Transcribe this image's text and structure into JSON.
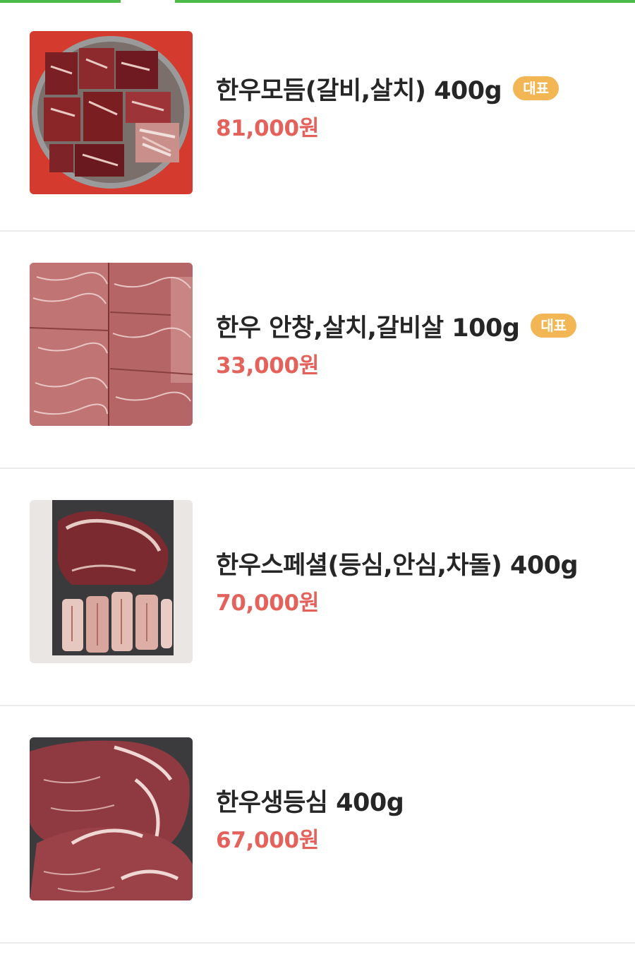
{
  "colors": {
    "accent_green": "#4cbb4a",
    "price_red": "#e3625b",
    "badge_orange": "#f2b655"
  },
  "menu": {
    "items": [
      {
        "name": "한우모듬(갈비,살치) 400g",
        "badge": "대표",
        "price": "81,000원",
        "image_icon": "beef-assorted-plate-photo"
      },
      {
        "name": "한우 안창,살치,갈비살 100g",
        "badge": "대표",
        "price": "33,000원",
        "image_icon": "beef-marbled-slices-photo"
      },
      {
        "name": "한우스페셜(등심,안심,차돌) 400g",
        "badge": "",
        "price": "70,000원",
        "image_icon": "beef-special-board-photo"
      },
      {
        "name": "한우생등심 400g",
        "badge": "",
        "price": "67,000원",
        "image_icon": "beef-sirloin-photo"
      }
    ]
  }
}
